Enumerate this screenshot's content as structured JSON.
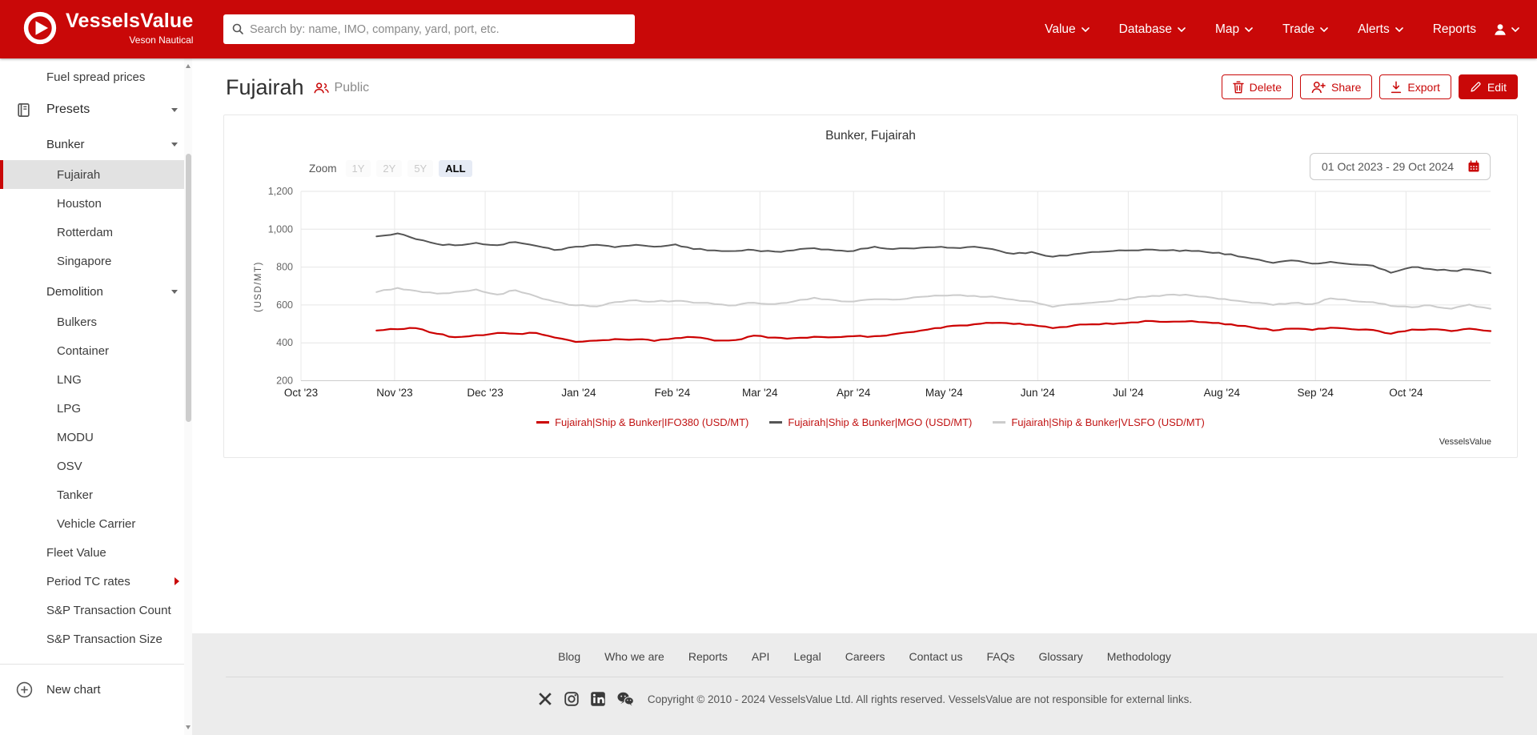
{
  "navbar": {
    "brand": {
      "name": "VesselsValue",
      "tagline": "Veson Nautical",
      "logo_icon": "vesselsvalue-logo-icon"
    },
    "search": {
      "placeholder": "Search by: name, IMO, company, yard, port, etc.",
      "icon": "search-icon"
    },
    "items": [
      {
        "label": "Value",
        "dropdown": true
      },
      {
        "label": "Database",
        "dropdown": true
      },
      {
        "label": "Map",
        "dropdown": true
      },
      {
        "label": "Trade",
        "dropdown": true
      },
      {
        "label": "Alerts",
        "dropdown": true
      },
      {
        "label": "Reports",
        "dropdown": false
      }
    ],
    "account": {
      "icon": "user-icon",
      "dropdown": true
    }
  },
  "sidebar": {
    "items": [
      {
        "label": "Fuel spread prices",
        "level": 1
      },
      {
        "label": "Presets",
        "level": 0,
        "icon": "book-icon",
        "chevron": "down",
        "header": true
      },
      {
        "label": "Bunker",
        "level": 1,
        "chevron": "down",
        "group": true
      },
      {
        "label": "Fujairah",
        "level": 2,
        "selected": true
      },
      {
        "label": "Houston",
        "level": 2
      },
      {
        "label": "Rotterdam",
        "level": 2
      },
      {
        "label": "Singapore",
        "level": 2
      },
      {
        "label": "Demolition",
        "level": 1,
        "chevron": "down",
        "group": true
      },
      {
        "label": "Bulkers",
        "level": 2
      },
      {
        "label": "Container",
        "level": 2
      },
      {
        "label": "LNG",
        "level": 2
      },
      {
        "label": "LPG",
        "level": 2
      },
      {
        "label": "MODU",
        "level": 2
      },
      {
        "label": "OSV",
        "level": 2
      },
      {
        "label": "Tanker",
        "level": 2
      },
      {
        "label": "Vehicle Carrier",
        "level": 2
      },
      {
        "label": "Fleet Value",
        "level": 1
      },
      {
        "label": "Period TC rates",
        "level": 1,
        "chevron": "right-red"
      },
      {
        "label": "S&P Transaction Count",
        "level": 1
      },
      {
        "label": "S&P Transaction Size",
        "level": 1
      }
    ],
    "new_chart": {
      "label": "New chart",
      "icon": "plus-circle-icon"
    }
  },
  "header": {
    "title": "Fujairah",
    "visibility": {
      "icon": "group-icon",
      "label": "Public"
    },
    "buttons": [
      {
        "label": "Delete",
        "icon": "trash-icon",
        "variant": "outline"
      },
      {
        "label": "Share",
        "icon": "person-plus-icon",
        "variant": "outline"
      },
      {
        "label": "Export",
        "icon": "download-icon",
        "variant": "outline"
      },
      {
        "label": "Edit",
        "icon": "pencil-icon",
        "variant": "solid"
      }
    ]
  },
  "chart": {
    "title": "Bunker, Fujairah",
    "zoom": {
      "label": "Zoom",
      "options": [
        {
          "label": "1Y",
          "state": "disabled"
        },
        {
          "label": "2Y",
          "state": "disabled"
        },
        {
          "label": "5Y",
          "state": "disabled"
        },
        {
          "label": "ALL",
          "state": "active"
        }
      ]
    },
    "date_range": {
      "value": "01 Oct 2023 - 29 Oct 2024",
      "icon": "calendar-icon"
    },
    "watermark": "VesselsValue"
  },
  "chart_data": {
    "type": "line",
    "title": "Bunker, Fujairah",
    "xlabel": "",
    "ylabel": "(USD/MT)",
    "ylim": [
      200,
      1200
    ],
    "yticks": [
      200,
      400,
      600,
      800,
      1000,
      1200
    ],
    "ytick_labels": [
      "200",
      "400",
      "600",
      "800",
      "1,000",
      "1,200"
    ],
    "xlim_days_from_2023_10_01": [
      0,
      394
    ],
    "xticks": [
      {
        "day": 0,
        "label": "Oct '23"
      },
      {
        "day": 31,
        "label": "Nov '23"
      },
      {
        "day": 61,
        "label": "Dec '23"
      },
      {
        "day": 92,
        "label": "Jan '24"
      },
      {
        "day": 123,
        "label": "Feb '24"
      },
      {
        "day": 152,
        "label": "Mar '24"
      },
      {
        "day": 183,
        "label": "Apr '24"
      },
      {
        "day": 213,
        "label": "May '24"
      },
      {
        "day": 244,
        "label": "Jun '24"
      },
      {
        "day": 274,
        "label": "Jul '24"
      },
      {
        "day": 305,
        "label": "Aug '24"
      },
      {
        "day": 336,
        "label": "Sep '24"
      },
      {
        "day": 366,
        "label": "Oct '24"
      }
    ],
    "days": [
      25,
      32,
      38,
      45,
      51,
      58,
      65,
      71,
      78,
      84,
      91,
      98,
      104,
      111,
      117,
      124,
      130,
      137,
      144,
      150,
      157,
      163,
      170,
      177,
      183,
      190,
      196,
      203,
      210,
      216,
      223,
      229,
      236,
      242,
      249,
      256,
      262,
      269,
      275,
      282,
      289,
      295,
      302,
      308,
      315,
      322,
      328,
      335,
      341,
      348,
      355,
      361,
      368,
      374,
      381,
      387,
      394
    ],
    "series": [
      {
        "name": "Fujairah|Ship & Bunker|IFO380 (USD/MT)",
        "color": "#cc0000",
        "values": [
          465,
          472,
          478,
          448,
          430,
          440,
          452,
          448,
          452,
          428,
          405,
          412,
          420,
          418,
          410,
          425,
          430,
          412,
          415,
          438,
          428,
          425,
          432,
          430,
          435,
          435,
          445,
          458,
          478,
          490,
          498,
          505,
          500,
          495,
          478,
          492,
          498,
          500,
          508,
          515,
          512,
          515,
          505,
          498,
          482,
          465,
          475,
          468,
          480,
          472,
          468,
          448,
          470,
          472,
          462,
          475,
          462
        ]
      },
      {
        "name": "Fujairah|Ship & Bunker|MGO (USD/MT)",
        "color": "#555555",
        "values": [
          962,
          978,
          948,
          922,
          915,
          928,
          916,
          932,
          912,
          890,
          908,
          918,
          905,
          918,
          908,
          920,
          895,
          888,
          885,
          890,
          882,
          888,
          900,
          888,
          885,
          908,
          895,
          898,
          905,
          902,
          908,
          895,
          870,
          880,
          855,
          868,
          880,
          885,
          888,
          892,
          890,
          885,
          875,
          868,
          845,
          822,
          835,
          818,
          828,
          815,
          808,
          770,
          800,
          790,
          780,
          788,
          768
        ]
      },
      {
        "name": "Fujairah|Ship & Bunker|VLSFO (USD/MT)",
        "color": "#cccccc",
        "values": [
          668,
          690,
          675,
          660,
          668,
          682,
          655,
          678,
          645,
          618,
          598,
          592,
          615,
          625,
          618,
          622,
          612,
          605,
          598,
          612,
          605,
          618,
          638,
          625,
          618,
          630,
          628,
          640,
          650,
          652,
          648,
          645,
          628,
          618,
          590,
          605,
          612,
          622,
          635,
          648,
          655,
          650,
          638,
          625,
          612,
          600,
          610,
          605,
          635,
          622,
          615,
          595,
          588,
          598,
          580,
          602,
          580
        ]
      }
    ],
    "grid": true,
    "legend_position": "bottom"
  },
  "footer": {
    "links": [
      "Blog",
      "Who we are",
      "Reports",
      "API",
      "Legal",
      "Careers",
      "Contact us",
      "FAQs",
      "Glossary",
      "Methodology"
    ],
    "social_icons": [
      "x-icon",
      "instagram-icon",
      "linkedin-icon",
      "wechat-icon"
    ],
    "copyright": "Copyright © 2010 - 2024 VesselsValue Ltd. All rights reserved. VesselsValue are not responsible for external links."
  },
  "colors": {
    "brand_red": "#c90808",
    "series_ifo380": "#cc0000",
    "series_mgo": "#555555",
    "series_vlsfo": "#cccccc",
    "zoom_active_bg": "#e6ebf5",
    "selected_item_bg": "#e2e2e2",
    "footer_bg": "#ececec",
    "legend_text": "#c11414"
  }
}
